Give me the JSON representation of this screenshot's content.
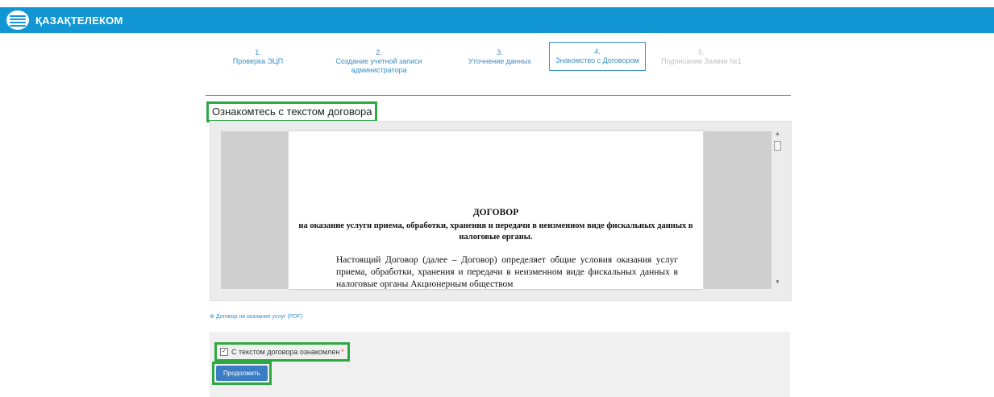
{
  "header": {
    "brand": "ҚАЗАҚТЕЛЕКОМ",
    "brand_color": "#1196d3"
  },
  "steps": [
    {
      "num": "1.",
      "label": "Проверка ЭЦП",
      "state": "done"
    },
    {
      "num": "2.",
      "label": "Создание учетной записи администратора",
      "state": "done"
    },
    {
      "num": "3.",
      "label": "Уточнение данных",
      "state": "done"
    },
    {
      "num": "4.",
      "label": "Знакомство с Договором",
      "state": "active"
    },
    {
      "num": "5.",
      "label": "Подписание Заявки №1",
      "state": "disabled"
    }
  ],
  "section_title": "Ознакомтесь с текстом договора",
  "document": {
    "title": "ДОГОВОР",
    "subtitle": "на оказание услуги приема, обработки, хранения и передачи в неизменном виде фискальных данных в налоговые органы.",
    "body": "Настоящий Договор (далее – Договор) определяет общие условия оказания услуг приема, обработки, хранения и передачи в неизменном виде фискальных данных в налоговые органы Акционерным обществом"
  },
  "pdf_link": "Договор на оказание услуг (PDF)",
  "agreement": {
    "checkbox_label": "С текстом договора ознакомлен",
    "required_mark": "*",
    "checked": true
  },
  "continue_button": "Продолжить",
  "highlight_color": "#2ea843"
}
